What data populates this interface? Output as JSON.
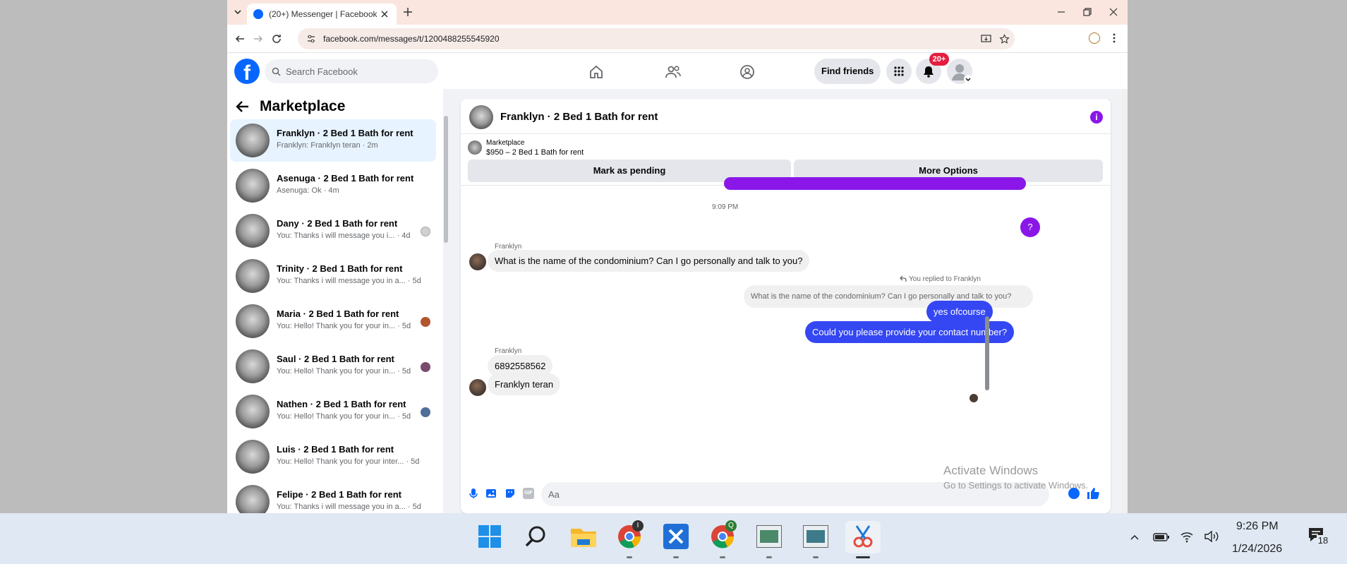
{
  "browser": {
    "tab_title": "(20+) Messenger | Facebook",
    "url": "facebook.com/messages/t/1200488255545920"
  },
  "fbnav": {
    "search_placeholder": "Search Facebook",
    "find_friends": "Find friends",
    "notif_badge": "20+"
  },
  "sidebar": {
    "title": "Marketplace",
    "conversations": [
      {
        "name": "Franklyn · 2 Bed 1 Bath for rent",
        "preview": "Franklyn: Franklyn teran · 2m"
      },
      {
        "name": "Asenuga · 2 Bed 1 Bath for rent",
        "preview": "Asenuga: Ok · 4m"
      },
      {
        "name": "Dany · 2 Bed 1 Bath for rent",
        "preview": "You: Thanks i will message you i... · 4d"
      },
      {
        "name": "Trinity · 2 Bed 1 Bath for rent",
        "preview": "You: Thanks i will message you in a... · 5d"
      },
      {
        "name": "Maria · 2 Bed 1 Bath for rent",
        "preview": "You: Hello! Thank you for your in... · 5d"
      },
      {
        "name": "Saul · 2 Bed 1 Bath for rent",
        "preview": "You: Hello! Thank you for your in... · 5d"
      },
      {
        "name": "Nathen · 2 Bed 1 Bath for rent",
        "preview": "You: Hello! Thank you for your in... · 5d"
      },
      {
        "name": "Luis · 2 Bed 1 Bath for rent",
        "preview": "You: Hello! Thank you for your inter... · 5d"
      },
      {
        "name": "Felipe · 2 Bed 1 Bath for rent",
        "preview": "You: Thanks i will message you in a... · 5d"
      }
    ]
  },
  "chat": {
    "header_title": "Franklyn · 2 Bed 1 Bath for rent",
    "listing_label": "Marketplace",
    "listing_detail": "$950 – 2 Bed 1 Bath for rent",
    "mark_pending": "Mark as pending",
    "more_options": "More Options",
    "time_divider": "9:09 PM",
    "question_mark": "?",
    "sender1": "Franklyn",
    "msg1": "What is the name of the condominium? Can I go personally and talk to you?",
    "replied_label": "You replied to Franklyn",
    "quoted": "What is the name of the condominium? Can I go personally and talk to you?",
    "out1": "yes ofcourse",
    "out2": "Could you please provide your contact number?",
    "sender2": "Franklyn",
    "msg2": "6892558562",
    "msg3": "Franklyn teran",
    "composer_placeholder": "Aa"
  },
  "watermark": {
    "line1": "Activate Windows",
    "line2": "Go to Settings to activate Windows."
  },
  "taskbar": {
    "time": "9:26 PM",
    "date": "1/24/2026",
    "notif_count": "18",
    "chrome_badge": "I",
    "chrome2_badge": "Q"
  },
  "colors": {
    "accent": "#3447f3",
    "fb_blue": "#0866ff",
    "purple": "#8a17e8"
  }
}
